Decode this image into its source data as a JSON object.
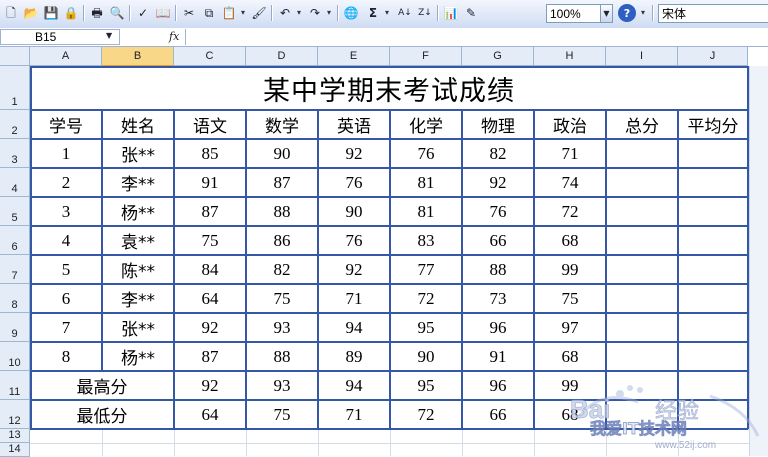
{
  "toolbar": {
    "zoom": "100%",
    "font_name": "宋体",
    "sigma_glyph": "Σ",
    "sort_asc": "A↓",
    "sort_desc": "Z↓",
    "help_glyph": "?"
  },
  "formula_bar": {
    "cell_ref": "B15",
    "fx_label": "fx"
  },
  "columns": [
    "A",
    "B",
    "C",
    "D",
    "E",
    "F",
    "G",
    "H",
    "I",
    "J"
  ],
  "selected_column": "B",
  "rows": [
    "1",
    "2",
    "3",
    "4",
    "5",
    "6",
    "7",
    "8",
    "9",
    "10",
    "11",
    "12",
    "13",
    "14"
  ],
  "sheet": {
    "title": "某中学期末考试成绩",
    "headers": [
      "学号",
      "姓名",
      "语文",
      "数学",
      "英语",
      "化学",
      "物理",
      "政治",
      "总分",
      "平均分"
    ],
    "students": [
      {
        "id": "1",
        "name": "张**",
        "scores": [
          "85",
          "90",
          "92",
          "76",
          "82",
          "71"
        ]
      },
      {
        "id": "2",
        "name": "李**",
        "scores": [
          "91",
          "87",
          "76",
          "81",
          "92",
          "74"
        ]
      },
      {
        "id": "3",
        "name": "杨**",
        "scores": [
          "87",
          "88",
          "90",
          "81",
          "76",
          "72"
        ]
      },
      {
        "id": "4",
        "name": "袁**",
        "scores": [
          "75",
          "86",
          "76",
          "83",
          "66",
          "68"
        ]
      },
      {
        "id": "5",
        "name": "陈**",
        "scores": [
          "84",
          "82",
          "92",
          "77",
          "88",
          "99"
        ]
      },
      {
        "id": "6",
        "name": "李**",
        "scores": [
          "64",
          "75",
          "71",
          "72",
          "73",
          "75"
        ]
      },
      {
        "id": "7",
        "name": "张**",
        "scores": [
          "92",
          "93",
          "94",
          "95",
          "96",
          "97"
        ]
      },
      {
        "id": "8",
        "name": "杨**",
        "scores": [
          "87",
          "88",
          "89",
          "90",
          "91",
          "68"
        ]
      }
    ],
    "max_row": {
      "label": "最高分",
      "scores": [
        "92",
        "93",
        "94",
        "95",
        "96",
        "99"
      ]
    },
    "min_row": {
      "label": "最低分",
      "scores": [
        "64",
        "75",
        "71",
        "72",
        "66",
        "68"
      ]
    }
  },
  "watermark": {
    "brand": "Bai",
    "brand_cn": "经验",
    "sub": "我爱IT技术网",
    "url": "www.52ij.com"
  },
  "colors": {
    "table_border": "#3557a8",
    "header_bg": "#e4ecf7",
    "selected_header": "#f8d888"
  }
}
